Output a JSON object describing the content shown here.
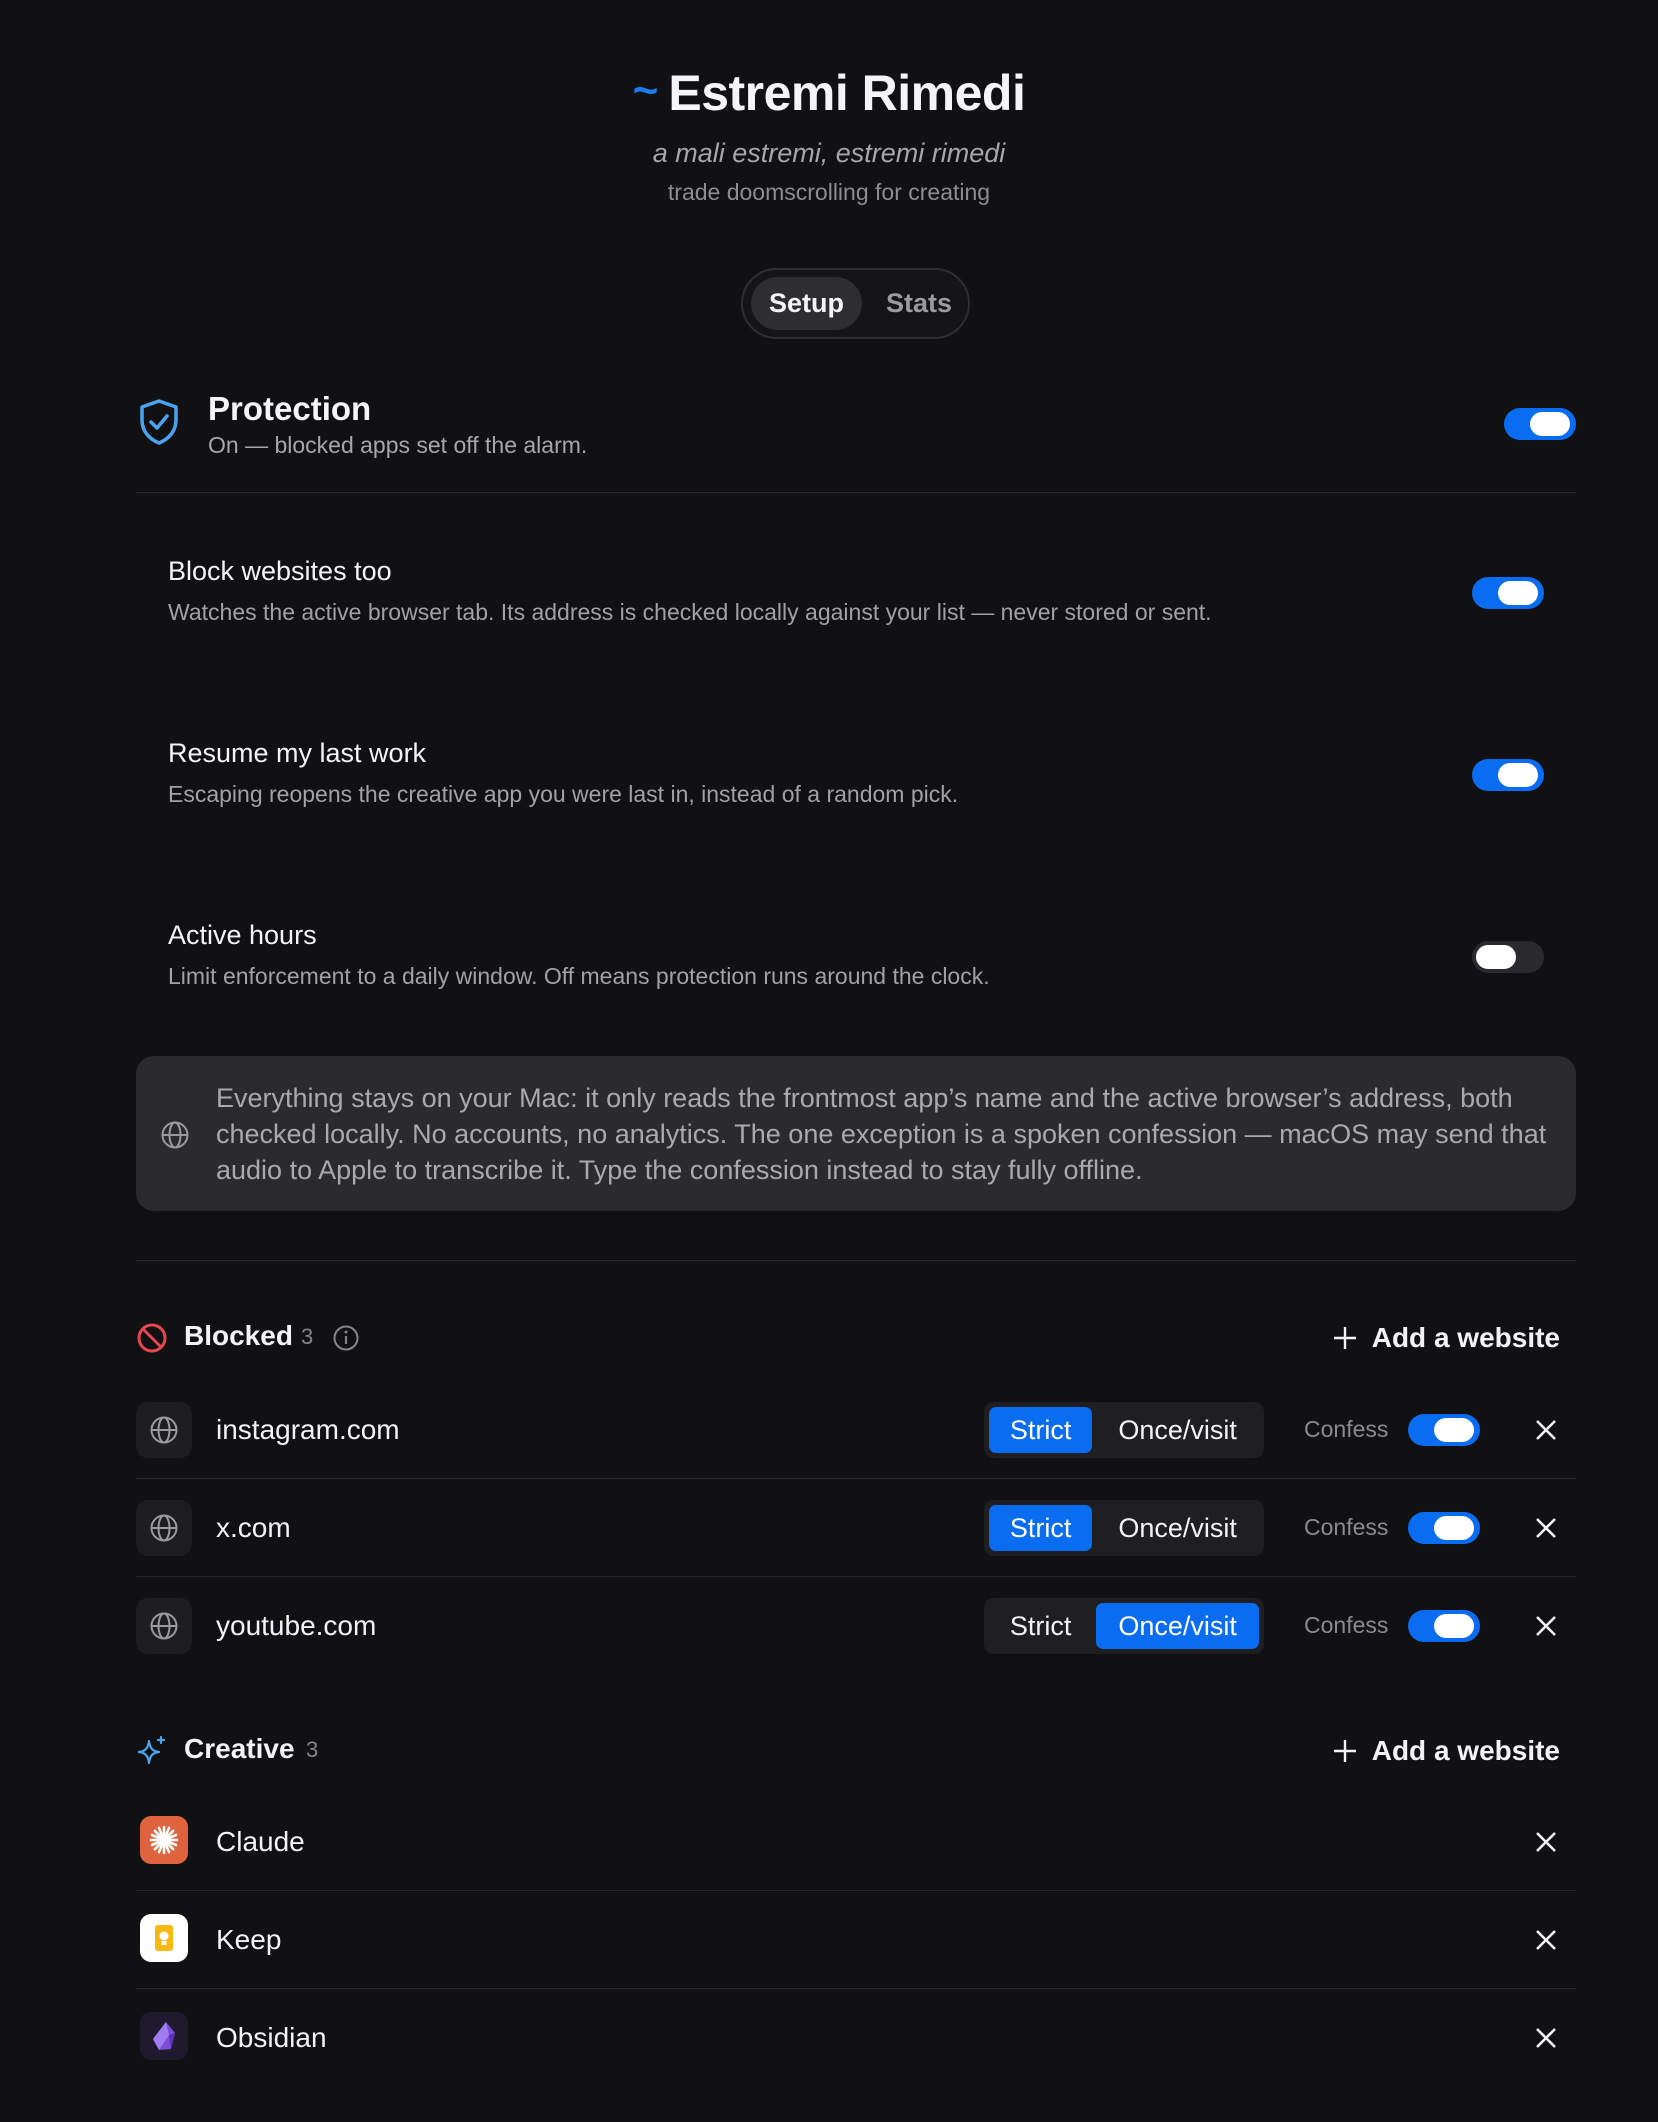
{
  "header": {
    "tilde": "~",
    "title": "Estremi Rimedi",
    "motto": "a mali estremi, estremi rimedi",
    "tagline": "trade doomscrolling for creating"
  },
  "tabs": [
    {
      "label": "Setup",
      "active": true
    },
    {
      "label": "Stats",
      "active": false
    }
  ],
  "protection": {
    "title": "Protection",
    "subtitle": "On — blocked apps set off the alarm.",
    "enabled": true
  },
  "settings": [
    {
      "title": "Block websites too",
      "description": "Watches the active browser tab. Its address is checked locally against your list — never stored or sent.",
      "enabled": true
    },
    {
      "title": "Resume my last work",
      "description": "Escaping reopens the creative app you were last in, instead of a random pick.",
      "enabled": true
    },
    {
      "title": "Active hours",
      "description": "Limit enforcement to a daily window. Off means protection runs around the clock.",
      "enabled": false
    }
  ],
  "privacy_note": "Everything stays on your Mac: it only reads the frontmost app’s name and the active browser’s address, both checked locally. No accounts, no analytics. The one exception is a spoken confession — macOS may send that audio to Apple to transcribe it. Type the confession instead to stay fully offline.",
  "blocked": {
    "title": "Blocked",
    "count": "3",
    "add_label": "Add a website",
    "mode_strict": "Strict",
    "mode_once": "Once/visit",
    "confess_label": "Confess",
    "items": [
      {
        "name": "instagram.com",
        "mode": "strict",
        "confess": true
      },
      {
        "name": "x.com",
        "mode": "strict",
        "confess": true
      },
      {
        "name": "youtube.com",
        "mode": "once",
        "confess": true
      }
    ]
  },
  "creative": {
    "title": "Creative",
    "count": "3",
    "add_label": "Add a website",
    "items": [
      {
        "name": "Claude",
        "icon": "claude-icon"
      },
      {
        "name": "Keep",
        "icon": "keep-icon"
      },
      {
        "name": "Obsidian",
        "icon": "obsidian-icon"
      }
    ]
  },
  "colors": {
    "accent": "#0a6cf0",
    "background": "#111113",
    "blocked_icon": "#e5484d",
    "creative_icon": "#4aa3f0"
  }
}
